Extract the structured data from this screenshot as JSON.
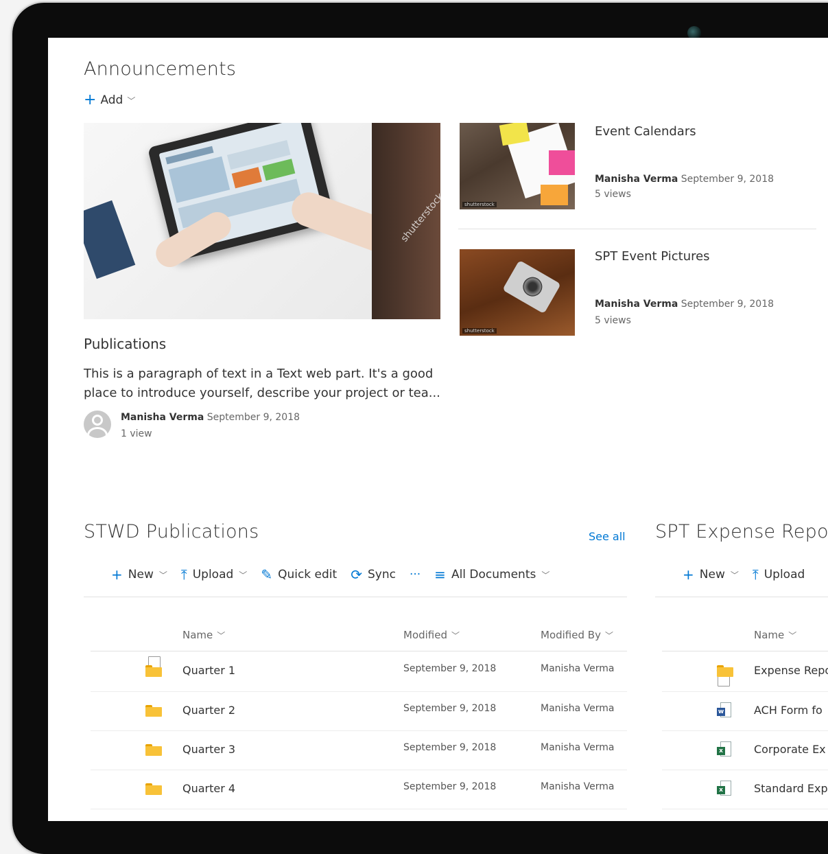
{
  "announcements": {
    "title": "Announcements",
    "add_label": "Add"
  },
  "hero": {
    "title": "Publications",
    "body": "This is a paragraph of text in a Text web part. It's a good place to introduce yourself, describe your project or tea...",
    "author": "Manisha Verma",
    "date": "September 9, 2018",
    "views": "1 view",
    "watermark": "shutterstock"
  },
  "news": [
    {
      "title": "Event Calendars",
      "author": "Manisha Verma",
      "date": "September 9, 2018",
      "views": "5 views"
    },
    {
      "title": "SPT Event Pictures",
      "author": "Manisha Verma",
      "date": "September 9, 2018",
      "views": "5 views"
    }
  ],
  "stwd": {
    "title": "STWD Publications",
    "see_all": "See all",
    "toolbar": {
      "new": "New",
      "upload": "Upload",
      "quick_edit": "Quick edit",
      "sync": "Sync",
      "more": "···",
      "view": "All Documents"
    },
    "columns": {
      "name": "Name",
      "modified": "Modified",
      "modified_by": "Modified By"
    },
    "rows": [
      {
        "name": "Quarter 1",
        "modified": "September 9, 2018",
        "modified_by": "Manisha Verma"
      },
      {
        "name": "Quarter 2",
        "modified": "September 9, 2018",
        "modified_by": "Manisha Verma"
      },
      {
        "name": "Quarter 3",
        "modified": "September 9, 2018",
        "modified_by": "Manisha Verma"
      },
      {
        "name": "Quarter 4",
        "modified": "September 9, 2018",
        "modified_by": "Manisha Verma"
      }
    ]
  },
  "spt": {
    "title": "SPT Expense Repor",
    "toolbar": {
      "new": "New",
      "upload": "Upload"
    },
    "columns": {
      "name": "Name"
    },
    "rows": [
      {
        "name": "Expense Repo",
        "type": "folder"
      },
      {
        "name": "ACH Form fo",
        "type": "word"
      },
      {
        "name": "Corporate Ex",
        "type": "excel"
      },
      {
        "name": "Standard Exp",
        "type": "excel"
      }
    ]
  },
  "colors": {
    "accent": "#0078d4",
    "folder": "#f8c238",
    "word": "#2b579a",
    "excel": "#217346"
  }
}
